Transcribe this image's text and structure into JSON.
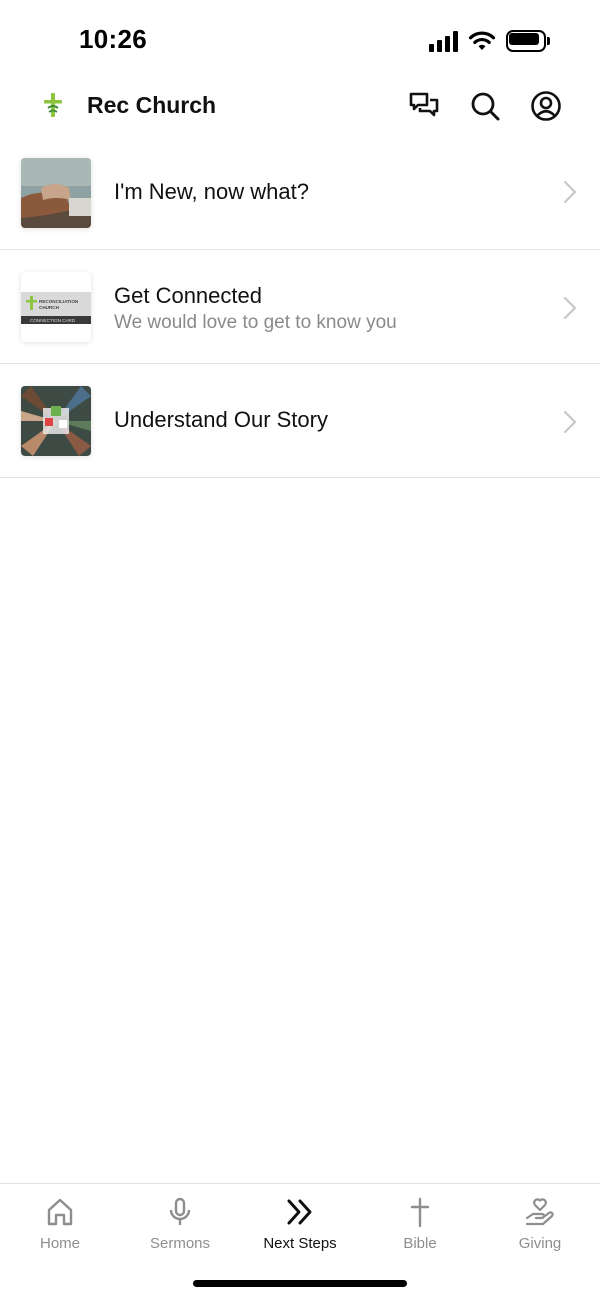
{
  "status_bar": {
    "time": "10:26"
  },
  "header": {
    "title": "Rec Church",
    "logo_color": "#8cc63f",
    "actions": [
      {
        "name": "chat-icon",
        "label": "Messages"
      },
      {
        "name": "search-icon",
        "label": "Search"
      },
      {
        "name": "profile-icon",
        "label": "Account"
      }
    ]
  },
  "list": {
    "items": [
      {
        "title": "I'm New, now what?",
        "subtitle": "",
        "thumbnail": "hands-on-bible-image"
      },
      {
        "title": "Get Connected",
        "subtitle": "We would love to get to know you",
        "thumbnail": "connection-card-image",
        "thumb_text": {
          "line1": "RECONCILIATION",
          "line2": "CHURCH",
          "line3": "CONNECTION CARD"
        }
      },
      {
        "title": "Understand Our Story",
        "subtitle": "",
        "thumbnail": "hands-together-image"
      }
    ]
  },
  "tab_bar": {
    "active_index": 2,
    "active_color": "#111111",
    "inactive_color": "#8e8e8e",
    "tabs": [
      {
        "label": "Home",
        "icon": "home-icon"
      },
      {
        "label": "Sermons",
        "icon": "microphone-icon"
      },
      {
        "label": "Next Steps",
        "icon": "double-chevron-icon"
      },
      {
        "label": "Bible",
        "icon": "cross-icon"
      },
      {
        "label": "Giving",
        "icon": "heart-hand-icon"
      }
    ]
  }
}
